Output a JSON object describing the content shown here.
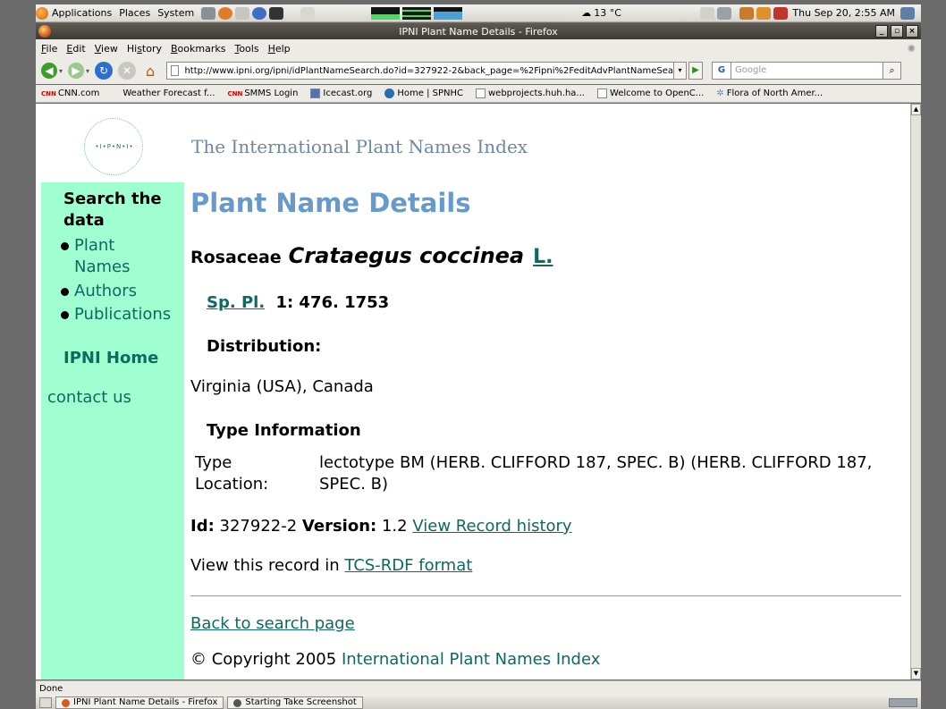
{
  "gnome_panel": {
    "menus": [
      "Applications",
      "Places",
      "System"
    ],
    "weather": "13 °C",
    "clock": "Thu Sep 20,  2:55 AM"
  },
  "window": {
    "title": "IPNI Plant Name Details - Firefox",
    "controls": {
      "minimize": "_",
      "maximize": "▫",
      "close": "×"
    }
  },
  "menubar": {
    "items": [
      {
        "mnemonic": "F",
        "rest": "ile"
      },
      {
        "mnemonic": "E",
        "rest": "dit"
      },
      {
        "mnemonic": "V",
        "rest": "iew"
      },
      {
        "pre": "Hi",
        "mnemonic": "s",
        "rest": "tory"
      },
      {
        "mnemonic": "B",
        "rest": "ookmarks"
      },
      {
        "mnemonic": "T",
        "rest": "ools"
      },
      {
        "mnemonic": "H",
        "rest": "elp"
      }
    ]
  },
  "navbar": {
    "url": "http://www.ipni.org/ipni/idPlantNameSearch.do?id=327922-2&back_page=%2Fipni%2FeditAdvPlantNameSea",
    "search_placeholder": "Google",
    "search_engine": "G"
  },
  "bookmarks": [
    {
      "label": "CNN.com",
      "icon": "cnn-icon"
    },
    {
      "label": "Weather Forecast f...",
      "icon": "none"
    },
    {
      "label": "SMMS Login",
      "icon": "cnn-icon"
    },
    {
      "label": "Icecast.org",
      "icon": "icecast-icon"
    },
    {
      "label": "Home | SPNHC",
      "icon": "spnhc-icon"
    },
    {
      "label": "webprojects.huh.ha...",
      "icon": "page-icon"
    },
    {
      "label": "Welcome to OpenC...",
      "icon": "page-icon"
    },
    {
      "label": "Flora of North Amer...",
      "icon": "flora-icon"
    }
  ],
  "page": {
    "logo_text": "•I•P•N•I•",
    "site_title": "The International Plant Names Index",
    "sidebar": {
      "heading": "Search the data",
      "links": [
        "Plant Names",
        "Authors",
        "Publications"
      ],
      "home": "IPNI Home",
      "contact": "contact us"
    },
    "title": "Plant Name Details",
    "family": "Rosaceae",
    "name": "Crataegus coccinea",
    "author": "L.",
    "publication_link": "Sp. Pl.",
    "publication_rest": "1: 476. 1753",
    "distribution_heading": "Distribution:",
    "distribution": "Virginia (USA), Canada",
    "type_heading": "Type Information",
    "type_label": "Type Location:",
    "type_value": "lectotype BM (HERB. CLIFFORD 187, SPEC. B) (HERB. CLIFFORD 187, SPEC. B)",
    "id_label": "Id:",
    "id_value": "327922-2",
    "version_label": "Version:",
    "version_value": "1.2",
    "history_link": "View Record history",
    "tcs_prefix": "View this record in",
    "tcs_link": "TCS-RDF format",
    "back_link": "Back to search page",
    "copyright_prefix": "© Copyright 2005",
    "copyright_owner": "International Plant Names Index"
  },
  "statusbar": {
    "text": "Done"
  },
  "taskbar": {
    "tasks": [
      "IPNI Plant Name Details - Firefox",
      "Starting Take Screenshot"
    ]
  }
}
